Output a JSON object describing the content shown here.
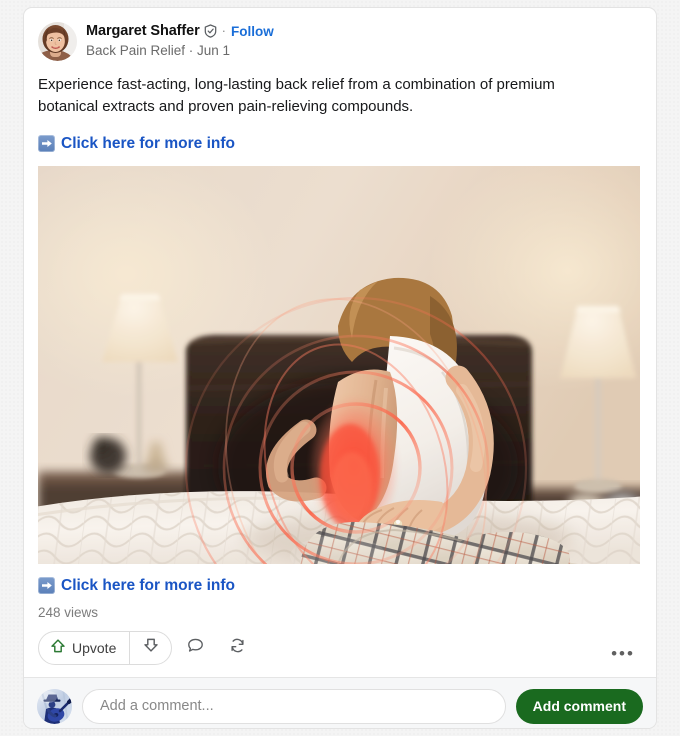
{
  "post": {
    "author": {
      "name": "Margaret Shaffer",
      "verified_icon": "shield-check-badge-icon",
      "follow_label": "Follow",
      "separator": "·",
      "avatar_icon": "author-avatar-photo"
    },
    "meta": {
      "community": "Back Pain Relief",
      "separator": "·",
      "date": "Jun 1",
      "subline": "Back Pain Relief · Jun 1"
    },
    "body_text": "Experience fast-acting, long-lasting back relief from a combination of premium botanical extracts and proven pain-relieving compounds.",
    "cta_top": {
      "icon": "right-arrow-emoji-icon",
      "label": "Click here for more info"
    },
    "media": {
      "alt": "Woman sitting on a bed in a bedroom holding her lower back, with a red pain glow highlighting the lumbar area",
      "scene_elements": [
        "table-lamp-left",
        "table-lamp-right",
        "dark-wood-headboard",
        "white-quilted-mattress",
        "nightstand-with-alarm-clock",
        "woman-in-white-tank-top",
        "plaid-pajama-pants",
        "red-pain-glow-lower-back",
        "red-concentric-pain-rings"
      ]
    },
    "cta_bottom": {
      "icon": "right-arrow-emoji-icon",
      "label": "Click here for more info"
    },
    "views": "248 views",
    "actions": {
      "upvote_label": "Upvote",
      "upvote_icon": "upvote-arrow-icon",
      "downvote_icon": "downvote-arrow-icon",
      "comment_icon": "comment-bubble-icon",
      "repost_icon": "repost-arrows-icon",
      "more_icon": "more-horizontal-icon",
      "more_label": "•••"
    }
  },
  "comment_bar": {
    "avatar_icon": "user-avatar-guitar-icon",
    "input_placeholder": "Add a comment...",
    "input_value": "",
    "submit_label": "Add comment"
  },
  "colors": {
    "page_background": "#f4f4f4",
    "card_background": "#ffffff",
    "link_blue": "#1a55c4",
    "follow_blue": "#1a6ed8",
    "submit_green": "#1a6a1f",
    "upvote_green": "#2c7a34",
    "muted_text": "#7c7c7c",
    "pain_red": "#f4604f"
  }
}
